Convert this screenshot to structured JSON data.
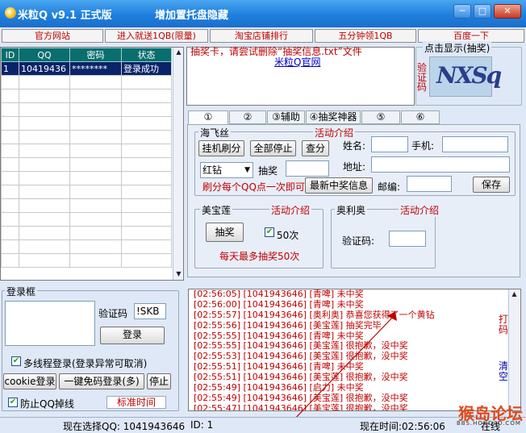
{
  "window": {
    "title": "米粒Q v9.1 正式版",
    "slogan": "增加置托盘隐藏",
    "minimize_icon": "minimize-icon",
    "maximize_icon": "maximize-icon",
    "close_icon": "close-icon",
    "min_glyph": "─",
    "max_glyph": "□",
    "close_glyph": "✕"
  },
  "toolbar": {
    "items": [
      "官方网站",
      "进入就送1QB(限量)",
      "淘宝店铺排行",
      "五分钟领1QB",
      "百度一下"
    ]
  },
  "grid": {
    "columns": [
      "ID",
      "QQ",
      "密码",
      "状态"
    ],
    "rows": [
      [
        "1",
        "10419436",
        "********",
        "登录成功"
      ]
    ]
  },
  "notice": {
    "text": "抽奖卡，请尝试删除“抽奖信息.txt”文件",
    "link": "米粒Q官网"
  },
  "captcha": {
    "legend": "点击显示(抽奖)",
    "label": "验证码",
    "image_text": "NXSq"
  },
  "tabs": [
    "①",
    "②",
    "③辅助",
    "④抽奖神器",
    "⑤",
    "⑥"
  ],
  "haifeisi": {
    "legend": "海飞丝",
    "activity": "活动介绍",
    "hang_button": "挂机刷分",
    "stop_all_button": "全部停止",
    "check_score_button": "查分",
    "diamond_select": "红钻",
    "draw_label": "抽奖",
    "hint": "刷分每个QQ点一次即可",
    "latest_prize_button": "最新中奖信息",
    "name_label": "姓名:",
    "phone_label": "手机:",
    "address_label": "地址:",
    "zip_label": "邮编:",
    "save_button": "保存"
  },
  "meibaolian": {
    "legend": "美宝莲",
    "activity": "活动介绍",
    "draw_button": "抽奖",
    "count_checkbox": "50次",
    "hint": "每天最多抽奖50次"
  },
  "aoliao": {
    "legend": "奥利奥",
    "activity": "活动介绍",
    "captcha_label": "验证码:"
  },
  "login": {
    "legend": "登录框",
    "captcha_label": "验证码",
    "captcha_value": "!SKB",
    "login_button": "登录",
    "multithread_checkbox": "多线程登录(登录异常可取消)",
    "cookie_button": "cookie登录",
    "one_click_button": "一键免码登录(多)",
    "stop_button": "停止",
    "anti_drop_checkbox": "防止QQ掉线",
    "standard_time_button": "标准时间"
  },
  "log": {
    "lines": [
      "[02:56:05] [1041943646] [青啤] 未中奖",
      "[02:56:00] [1041943646] [青啤] 未中奖",
      "[02:55:57] [1041943646] [奥利奥] 恭喜您获得了一个黄钻",
      "[02:55:56] [1041943646] [美宝莲] 抽奖完毕",
      "[02:55:55] [1041943646] [青啤] 未中奖",
      "[02:55:55] [1041943646] [美宝莲] 很抱歉，没中奖",
      "[02:55:53] [1041943646] [美宝莲] 很抱歉，没中奖",
      "[02:55:51] [1041943646] [青啤] 未中奖",
      "[02:55:51] [1041943646] [美宝莲] 很抱歉，没中奖",
      "[02:55:49] [1041943646] [启力] 未中奖",
      "[02:55:49] [1041943646] [美宝莲] 很抱歉，没中奖",
      "[02:55:47] [1041943646] [美宝莲] 很抱歉，没中奖"
    ],
    "side_label_top": "打码",
    "side_label_bottom": "清空"
  },
  "status": {
    "current_qq": "现在选择QQ: 1041943646",
    "id": "ID: 1",
    "time": "现在时间:02:56:06",
    "online": "在线"
  },
  "watermark": {
    "text": "猴岛论坛",
    "sub": "BBS.HOUDAO.COM"
  }
}
